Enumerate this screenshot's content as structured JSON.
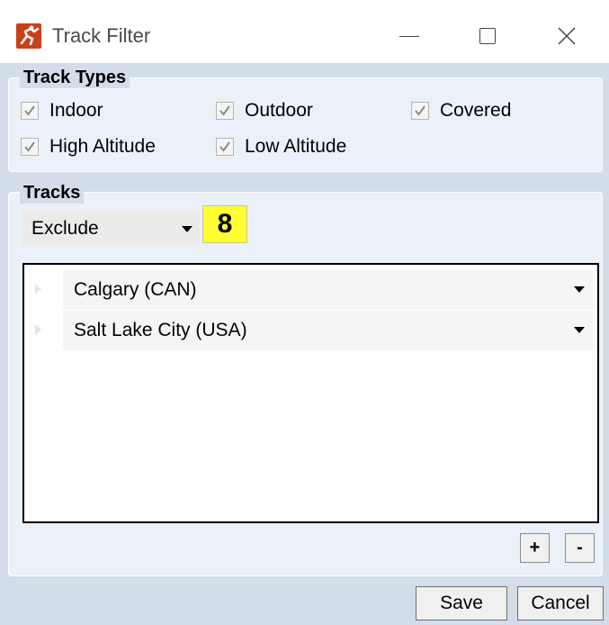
{
  "window": {
    "title": "Track Filter",
    "minimize_glyph": "—",
    "maximize_glyph": "□",
    "close_glyph": "✕"
  },
  "track_types": {
    "title": "Track Types",
    "options": [
      {
        "label": "Indoor",
        "checked": true
      },
      {
        "label": "Outdoor",
        "checked": true
      },
      {
        "label": "Covered",
        "checked": true
      },
      {
        "label": "High Altitude",
        "checked": true
      },
      {
        "label": "Low Altitude",
        "checked": true
      }
    ]
  },
  "tracks": {
    "title": "Tracks",
    "mode": "Exclude",
    "badge": "8",
    "items": [
      {
        "label": "Calgary (CAN)"
      },
      {
        "label": "Salt Lake City (USA)"
      }
    ],
    "add_label": "+",
    "remove_label": "-"
  },
  "footer": {
    "save_label": "Save",
    "cancel_label": "Cancel"
  },
  "colors": {
    "window_bg": "#d3dde9",
    "group_bg": "#ebf1f8",
    "badge_bg": "#ffff33",
    "app_icon": "#c8401a"
  }
}
